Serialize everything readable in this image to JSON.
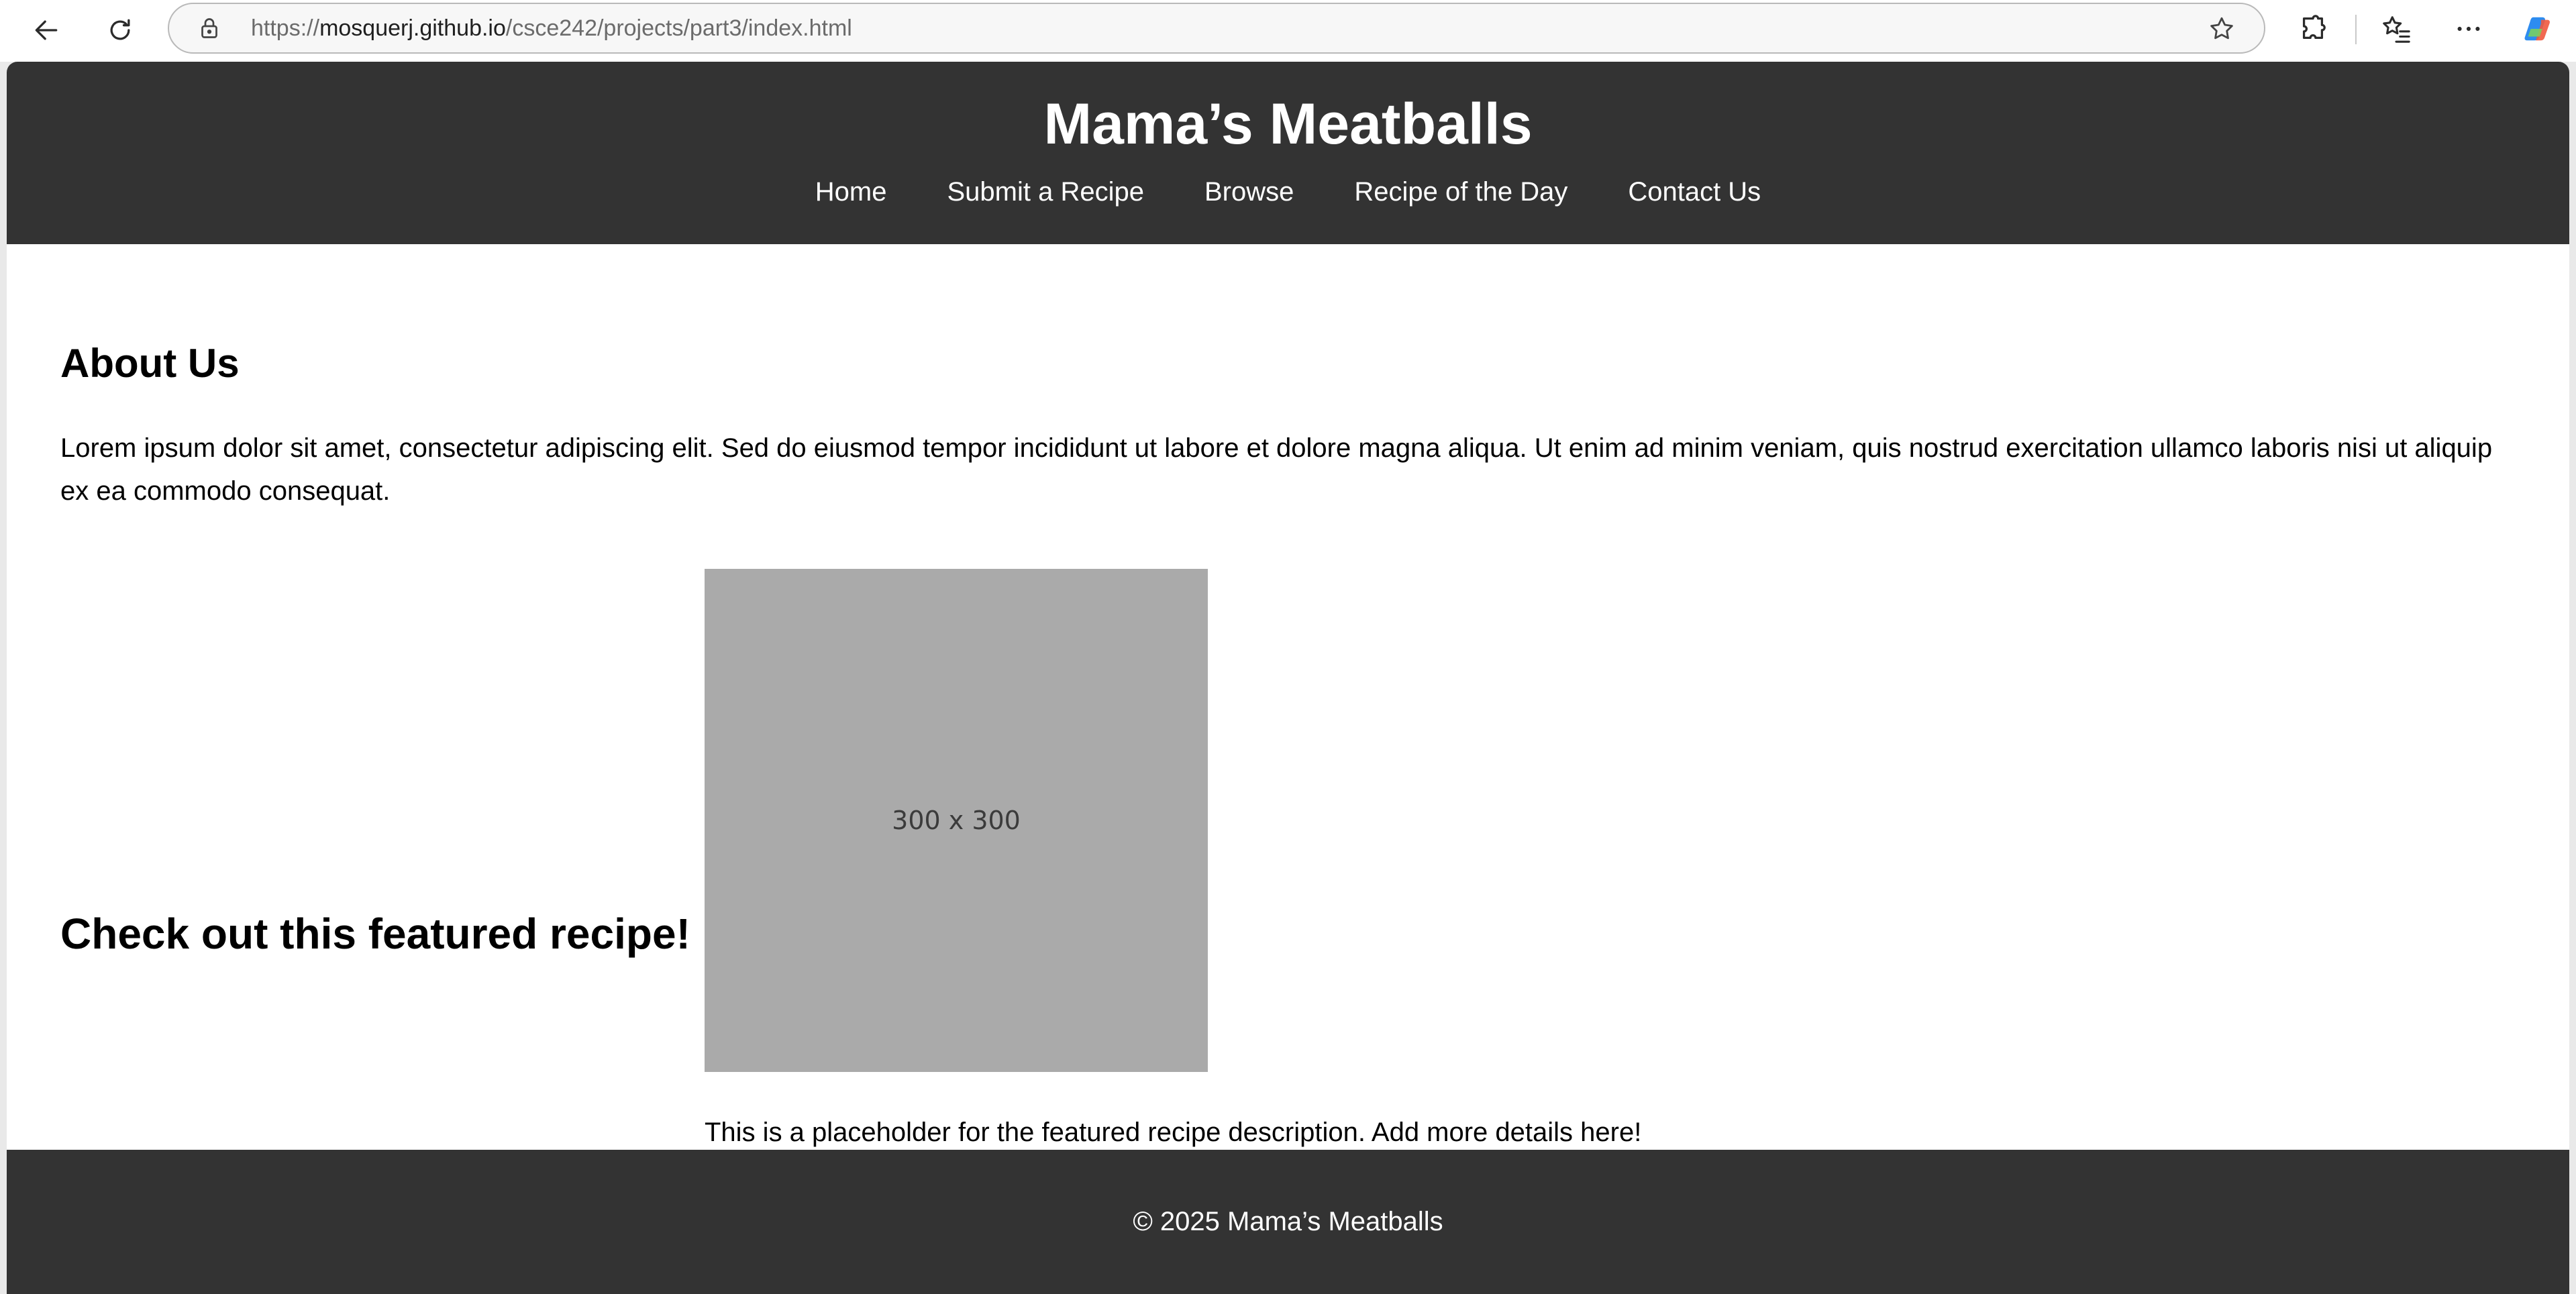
{
  "browser": {
    "url_prefix": "https://",
    "url_host": "mosquerj.github.io",
    "url_path": "/csce242/projects/part3/index.html"
  },
  "header": {
    "title": "Mama’s Meatballs",
    "nav": [
      {
        "label": "Home"
      },
      {
        "label": "Submit a Recipe"
      },
      {
        "label": "Browse"
      },
      {
        "label": "Recipe of the Day"
      },
      {
        "label": "Contact Us"
      }
    ]
  },
  "about": {
    "title": "About Us",
    "text": "Lorem ipsum dolor sit amet, consectetur adipiscing elit. Sed do eiusmod tempor incididunt ut labore et dolore magna aliqua. Ut enim ad minim veniam, quis nostrud exercitation ullamco laboris nisi ut aliquip ex ea commodo consequat."
  },
  "featured": {
    "title": "Check out this featured recipe!",
    "image_label": "300 x 300",
    "description": "This is a placeholder for the featured recipe description. Add more details here!"
  },
  "footer": {
    "text": "© 2025 Mama’s Meatballs"
  },
  "colors": {
    "header_bg": "#333333",
    "placeholder_bg": "#aaaaaa"
  }
}
